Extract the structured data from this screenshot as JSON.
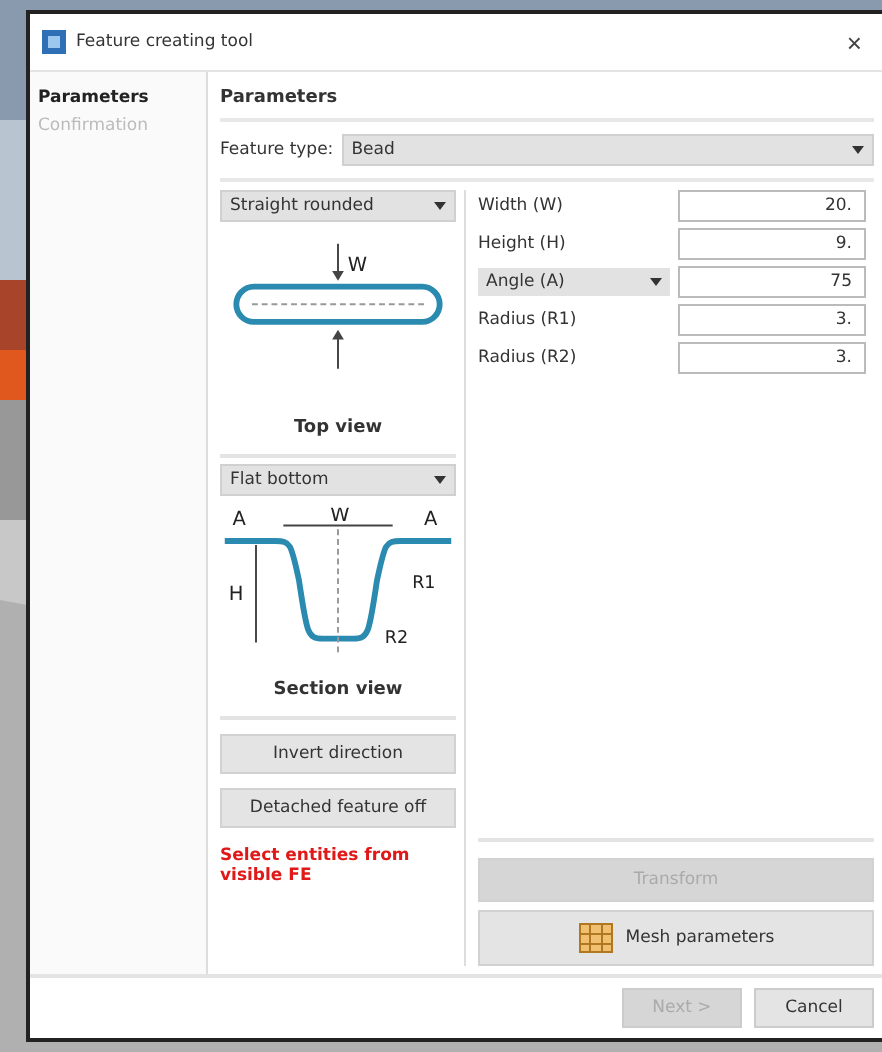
{
  "window": {
    "title": "Feature creating tool",
    "close": "×"
  },
  "steps": [
    {
      "label": "Parameters",
      "selected": true
    },
    {
      "label": "Confirmation",
      "selected": false
    }
  ],
  "heading": "Parameters",
  "feature_type": {
    "label": "Feature type:",
    "value": "Bead"
  },
  "top_view": {
    "shape": "Straight rounded",
    "caption": "Top view",
    "w": "W"
  },
  "section_view": {
    "shape": "Flat bottom",
    "caption": "Section view",
    "a": "A",
    "a2": "A",
    "w": "W",
    "h": "H",
    "r1": "R1",
    "r2": "R2"
  },
  "params": [
    {
      "label": "Width (W)",
      "value": "20.",
      "kind": "text"
    },
    {
      "label": "Height (H)",
      "value": "9.",
      "kind": "text"
    },
    {
      "label": "Angle (A)",
      "value": "75",
      "kind": "dropdown"
    },
    {
      "label": "Radius (R1)",
      "value": "3.",
      "kind": "text"
    },
    {
      "label": "Radius (R2)",
      "value": "3.",
      "kind": "text"
    }
  ],
  "invert_button": "Invert direction",
  "detached_button": "Detached feature off",
  "warning": "Select entities from visible FE",
  "transform_button": {
    "label": "Transform",
    "disabled": true
  },
  "mesh_button": "Mesh parameters",
  "next_button": {
    "label": "Next >",
    "disabled": true
  },
  "cancel_button": "Cancel"
}
